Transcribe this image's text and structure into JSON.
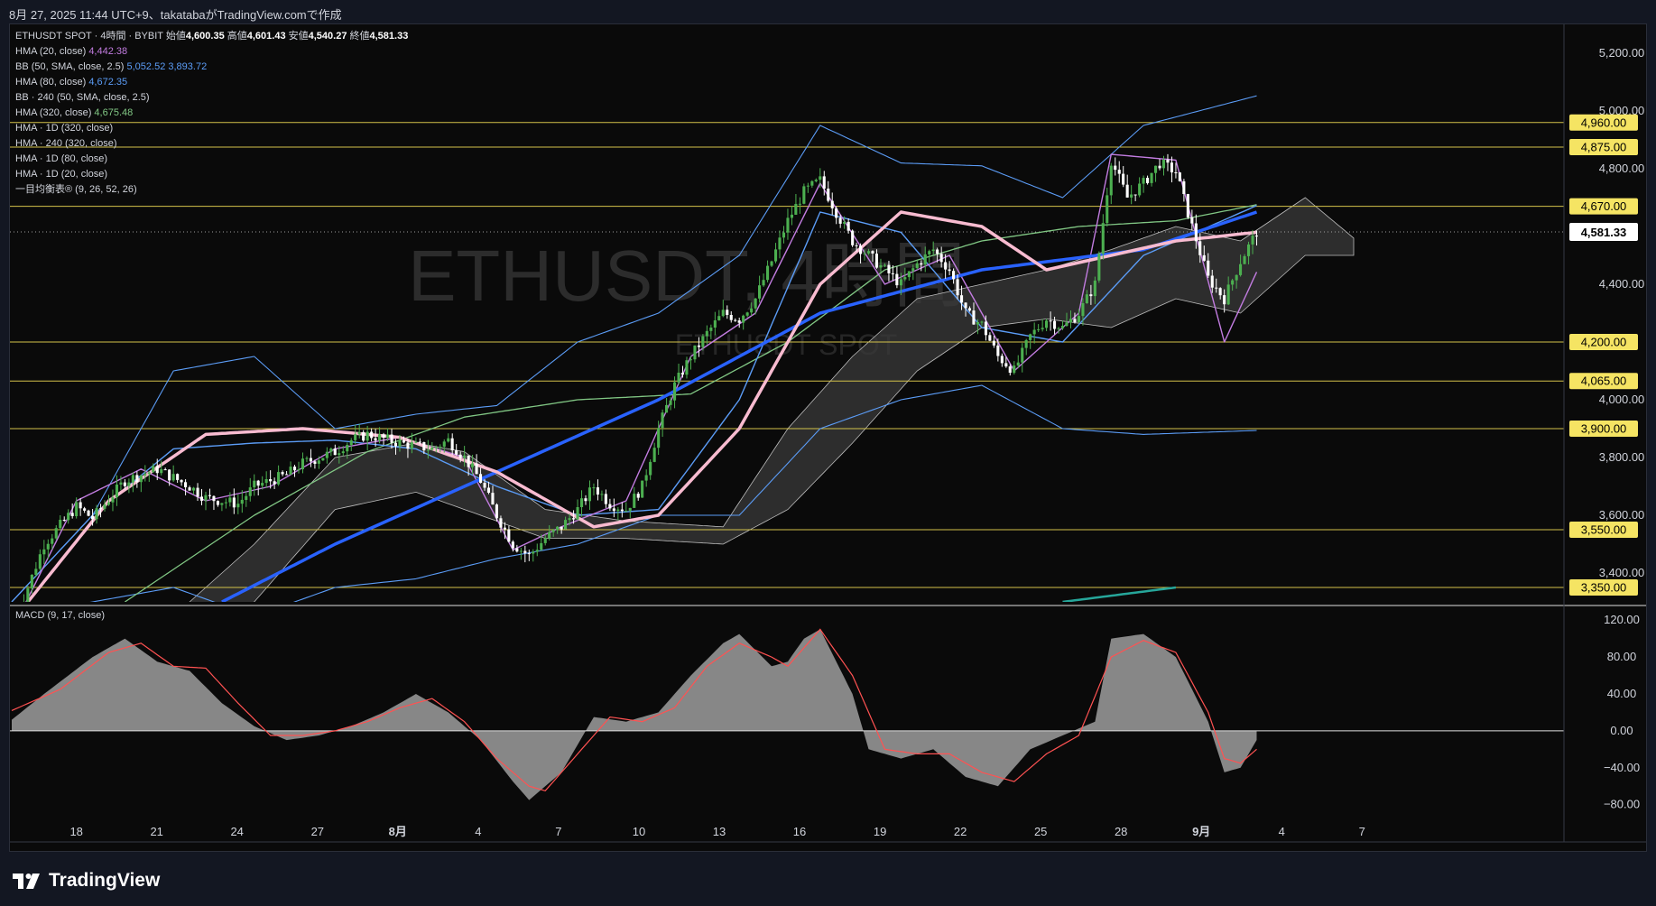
{
  "caption": "8月 27, 2025 11:44 UTC+9、takatabaがTradingView.comで作成",
  "legend": {
    "symbol_line": "ETHUSDT SPOT · 4時間 · BYBIT",
    "ohlc": [
      {
        "label": "始値",
        "value": "4,600.35"
      },
      {
        "label": "高値",
        "value": "4,601.43"
      },
      {
        "label": "安値",
        "value": "4,540.27"
      },
      {
        "label": "終値",
        "value": "4,581.33"
      }
    ],
    "indicators": [
      {
        "label": "HMA (20, close)",
        "values": [
          "4,442.38"
        ],
        "colors": [
          "#c27ce0"
        ]
      },
      {
        "label": "BB (50, SMA, close, 2.5)",
        "values": [
          "5,052.52",
          "3,893.72"
        ],
        "colors": [
          "#5b9cf6",
          "#5b9cf6"
        ]
      },
      {
        "label": "HMA (80, close)",
        "values": [
          "4,672.35"
        ],
        "colors": [
          "#5b9cf6"
        ]
      },
      {
        "label": "BB · 240 (50, SMA, close, 2.5)",
        "values": [],
        "colors": []
      },
      {
        "label": "HMA (320, close)",
        "values": [
          "4,675.48"
        ],
        "colors": [
          "#81c784"
        ]
      },
      {
        "label": "HMA · 1D (320, close)",
        "values": [],
        "colors": []
      },
      {
        "label": "HMA · 240 (320, close)",
        "values": [],
        "colors": []
      },
      {
        "label": "HMA · 1D (80, close)",
        "values": [],
        "colors": []
      },
      {
        "label": "HMA · 1D (20, close)",
        "values": [],
        "colors": []
      },
      {
        "label": "一目均衡表® (9, 26, 52, 26)",
        "values": [],
        "colors": []
      }
    ]
  },
  "watermark": {
    "main": "ETHUSDT, 4時間",
    "sub": "ETHUSDT SPOT"
  },
  "macd_label": "MACD (9, 17, close)",
  "brand": "TradingView",
  "colors": {
    "up": "#4caf50",
    "down": "#ffffff",
    "hline": "#d4c24a",
    "badge": "#f5e463",
    "bb": "#5b9cf6",
    "hma20": "#c27ce0",
    "hma80": "#5b9cf6",
    "hma320": "#81c784",
    "hma_daily": "#2962ff",
    "hma_daily20": "#f8bbd0",
    "macd": "#ff5252",
    "hist": "#9e9e9e"
  },
  "chart_data": [
    {
      "type": "candlestick",
      "title": "ETHUSDT SPOT · 4時間 · BYBIT",
      "y_axis_ticks": [
        "5,200.00",
        "5,000.00",
        "4,800.00",
        "4,400.00",
        "4,000.00",
        "3,800.00",
        "3,600.00",
        "3,400.00"
      ],
      "ylim": [
        3300,
        5300
      ],
      "x_axis_ticks": [
        "18",
        "21",
        "24",
        "27",
        "8月",
        "4",
        "7",
        "10",
        "13",
        "16",
        "19",
        "22",
        "25",
        "28",
        "9月",
        "4",
        "7"
      ],
      "horizontal_levels": [
        4960,
        4875,
        4670,
        4200,
        4065,
        3900,
        3550,
        3350
      ],
      "horizontal_level_labels": [
        "4,960.00",
        "4,875.00",
        "4,670.00",
        "4,200.00",
        "4,065.00",
        "3,900.00",
        "3,550.00",
        "3,350.00"
      ],
      "last_price": 4581.33,
      "last_price_label": "4,581.33",
      "price_path": [
        [
          0,
          3200
        ],
        [
          2,
          3500
        ],
        [
          4,
          3630
        ],
        [
          5,
          3590
        ],
        [
          7,
          3720
        ],
        [
          9,
          3760
        ],
        [
          11,
          3700
        ],
        [
          12,
          3660
        ],
        [
          14,
          3640
        ],
        [
          15,
          3700
        ],
        [
          17,
          3740
        ],
        [
          18,
          3780
        ],
        [
          20,
          3820
        ],
        [
          21,
          3860
        ],
        [
          22,
          3880
        ],
        [
          24,
          3850
        ],
        [
          26,
          3830
        ],
        [
          27,
          3860
        ],
        [
          28,
          3800
        ],
        [
          29,
          3720
        ],
        [
          30,
          3600
        ],
        [
          31,
          3500
        ],
        [
          32,
          3460
        ],
        [
          33,
          3520
        ],
        [
          34,
          3560
        ],
        [
          35,
          3620
        ],
        [
          36,
          3700
        ],
        [
          37,
          3640
        ],
        [
          38,
          3620
        ],
        [
          39,
          3700
        ],
        [
          40,
          3900
        ],
        [
          41,
          4050
        ],
        [
          42,
          4150
        ],
        [
          43,
          4230
        ],
        [
          44,
          4300
        ],
        [
          45,
          4280
        ],
        [
          46,
          4350
        ],
        [
          47,
          4480
        ],
        [
          48,
          4620
        ],
        [
          49,
          4720
        ],
        [
          50,
          4760
        ],
        [
          51,
          4650
        ],
        [
          52,
          4550
        ],
        [
          53,
          4500
        ],
        [
          54,
          4450
        ],
        [
          55,
          4400
        ],
        [
          56,
          4470
        ],
        [
          57,
          4520
        ],
        [
          58,
          4450
        ],
        [
          59,
          4300
        ],
        [
          60,
          4260
        ],
        [
          61,
          4150
        ],
        [
          62,
          4100
        ],
        [
          63,
          4220
        ],
        [
          64,
          4280
        ],
        [
          65,
          4250
        ],
        [
          66,
          4300
        ],
        [
          67,
          4400
        ],
        [
          68,
          4830
        ],
        [
          69,
          4700
        ],
        [
          70,
          4750
        ],
        [
          71,
          4820
        ],
        [
          72,
          4790
        ],
        [
          73,
          4600
        ],
        [
          74,
          4420
        ],
        [
          75,
          4350
        ],
        [
          76,
          4480
        ],
        [
          77,
          4581.33
        ]
      ],
      "ichimoku_cloud": {
        "upper": [
          [
            11,
            3300
          ],
          [
            15,
            3500
          ],
          [
            20,
            3800
          ],
          [
            25,
            3850
          ],
          [
            28,
            3820
          ],
          [
            33,
            3620
          ],
          [
            38,
            3580
          ],
          [
            44,
            3560
          ],
          [
            48,
            3900
          ],
          [
            52,
            4150
          ],
          [
            56,
            4350
          ],
          [
            60,
            4400
          ],
          [
            64,
            4450
          ],
          [
            68,
            4520
          ],
          [
            72,
            4600
          ],
          [
            76,
            4550
          ],
          [
            80,
            4700
          ],
          [
            83,
            4560
          ]
        ],
        "lower": [
          [
            11,
            3200
          ],
          [
            15,
            3300
          ],
          [
            20,
            3620
          ],
          [
            25,
            3680
          ],
          [
            28,
            3620
          ],
          [
            33,
            3520
          ],
          [
            38,
            3520
          ],
          [
            44,
            3500
          ],
          [
            48,
            3620
          ],
          [
            52,
            3850
          ],
          [
            56,
            4100
          ],
          [
            60,
            4250
          ],
          [
            64,
            4280
          ],
          [
            68,
            4250
          ],
          [
            72,
            4350
          ],
          [
            76,
            4300
          ],
          [
            80,
            4500
          ],
          [
            83,
            4500
          ]
        ]
      },
      "bollinger_upper": [
        [
          0,
          3300
        ],
        [
          5,
          3600
        ],
        [
          10,
          4100
        ],
        [
          15,
          4150
        ],
        [
          20,
          3900
        ],
        [
          25,
          3950
        ],
        [
          30,
          3980
        ],
        [
          35,
          4200
        ],
        [
          40,
          4300
        ],
        [
          45,
          4500
        ],
        [
          50,
          4950
        ],
        [
          55,
          4820
        ],
        [
          60,
          4810
        ],
        [
          65,
          4700
        ],
        [
          70,
          4950
        ],
        [
          77,
          5052.52
        ]
      ],
      "bollinger_lower": [
        [
          0,
          3250
        ],
        [
          5,
          3300
        ],
        [
          10,
          3350
        ],
        [
          15,
          3250
        ],
        [
          20,
          3350
        ],
        [
          25,
          3380
        ],
        [
          30,
          3450
        ],
        [
          35,
          3500
        ],
        [
          40,
          3600
        ],
        [
          45,
          3600
        ],
        [
          50,
          3900
        ],
        [
          55,
          4000
        ],
        [
          60,
          4050
        ],
        [
          65,
          3900
        ],
        [
          70,
          3880
        ],
        [
          77,
          3893.72
        ]
      ],
      "hma20": [
        [
          0,
          3200
        ],
        [
          4,
          3650
        ],
        [
          8,
          3760
        ],
        [
          12,
          3650
        ],
        [
          16,
          3700
        ],
        [
          20,
          3830
        ],
        [
          24,
          3870
        ],
        [
          28,
          3800
        ],
        [
          31,
          3480
        ],
        [
          34,
          3560
        ],
        [
          38,
          3650
        ],
        [
          42,
          4150
        ],
        [
          46,
          4300
        ],
        [
          50,
          4750
        ],
        [
          54,
          4400
        ],
        [
          58,
          4500
        ],
        [
          62,
          4100
        ],
        [
          66,
          4300
        ],
        [
          68,
          4850
        ],
        [
          72,
          4830
        ],
        [
          75,
          4200
        ],
        [
          77,
          4442.38
        ]
      ],
      "hma80": [
        [
          0,
          3300
        ],
        [
          5,
          3600
        ],
        [
          10,
          3830
        ],
        [
          15,
          3850
        ],
        [
          20,
          3860
        ],
        [
          25,
          3830
        ],
        [
          30,
          3700
        ],
        [
          35,
          3600
        ],
        [
          40,
          3620
        ],
        [
          45,
          4000
        ],
        [
          50,
          4650
        ],
        [
          55,
          4580
        ],
        [
          60,
          4250
        ],
        [
          65,
          4200
        ],
        [
          70,
          4500
        ],
        [
          77,
          4672.35
        ]
      ],
      "hma320": [
        [
          7,
          3300
        ],
        [
          15,
          3600
        ],
        [
          22,
          3820
        ],
        [
          28,
          3940
        ],
        [
          35,
          4000
        ],
        [
          42,
          4020
        ],
        [
          48,
          4200
        ],
        [
          54,
          4450
        ],
        [
          60,
          4550
        ],
        [
          66,
          4600
        ],
        [
          72,
          4620
        ],
        [
          77,
          4675.48
        ]
      ],
      "hma_daily_320": [
        [
          13,
          3300
        ],
        [
          20,
          3500
        ],
        [
          30,
          3750
        ],
        [
          40,
          4000
        ],
        [
          50,
          4300
        ],
        [
          60,
          4450
        ],
        [
          70,
          4520
        ],
        [
          77,
          4650
        ]
      ],
      "hma_daily_20": [
        [
          1,
          3300
        ],
        [
          6,
          3650
        ],
        [
          12,
          3880
        ],
        [
          18,
          3900
        ],
        [
          24,
          3870
        ],
        [
          30,
          3750
        ],
        [
          36,
          3560
        ],
        [
          40,
          3600
        ],
        [
          45,
          3900
        ],
        [
          50,
          4400
        ],
        [
          55,
          4650
        ],
        [
          60,
          4600
        ],
        [
          64,
          4450
        ],
        [
          68,
          4500
        ],
        [
          72,
          4550
        ],
        [
          77,
          4580
        ]
      ],
      "ichimoku_lagging": [
        [
          65,
          3300
        ],
        [
          72,
          3350
        ]
      ]
    },
    {
      "type": "area",
      "title": "MACD (9, 17, close)",
      "y_axis_ticks": [
        "120.00",
        "80.00",
        "40.00",
        "0.00",
        "−40.00",
        "−80.00"
      ],
      "ylim": [
        -95,
        130
      ],
      "zero_line": 0,
      "histogram": [
        [
          0,
          12
        ],
        [
          2,
          40
        ],
        [
          5,
          80
        ],
        [
          7,
          100
        ],
        [
          9,
          75
        ],
        [
          11,
          65
        ],
        [
          13,
          30
        ],
        [
          15,
          5
        ],
        [
          17,
          -10
        ],
        [
          19,
          -5
        ],
        [
          21,
          5
        ],
        [
          23,
          20
        ],
        [
          25,
          40
        ],
        [
          27,
          20
        ],
        [
          29,
          -10
        ],
        [
          31,
          -55
        ],
        [
          32,
          -75
        ],
        [
          34,
          -45
        ],
        [
          36,
          15
        ],
        [
          38,
          10
        ],
        [
          40,
          20
        ],
        [
          42,
          60
        ],
        [
          44,
          95
        ],
        [
          45,
          105
        ],
        [
          47,
          70
        ],
        [
          48,
          75
        ],
        [
          49,
          100
        ],
        [
          50,
          110
        ],
        [
          52,
          40
        ],
        [
          53,
          -20
        ],
        [
          55,
          -30
        ],
        [
          57,
          -20
        ],
        [
          59,
          -50
        ],
        [
          61,
          -60
        ],
        [
          63,
          -20
        ],
        [
          65,
          -5
        ],
        [
          67,
          10
        ],
        [
          68,
          100
        ],
        [
          70,
          105
        ],
        [
          72,
          80
        ],
        [
          74,
          10
        ],
        [
          75,
          -45
        ],
        [
          76,
          -40
        ],
        [
          77,
          -10
        ]
      ],
      "signal": [
        [
          0,
          22
        ],
        [
          3,
          45
        ],
        [
          6,
          85
        ],
        [
          8,
          95
        ],
        [
          10,
          70
        ],
        [
          12,
          68
        ],
        [
          14,
          30
        ],
        [
          16,
          -5
        ],
        [
          18,
          -5
        ],
        [
          20,
          0
        ],
        [
          22,
          10
        ],
        [
          24,
          25
        ],
        [
          26,
          35
        ],
        [
          28,
          10
        ],
        [
          30,
          -30
        ],
        [
          32,
          -60
        ],
        [
          33,
          -65
        ],
        [
          35,
          -25
        ],
        [
          37,
          15
        ],
        [
          39,
          10
        ],
        [
          41,
          25
        ],
        [
          43,
          70
        ],
        [
          45,
          95
        ],
        [
          47,
          80
        ],
        [
          48,
          70
        ],
        [
          50,
          110
        ],
        [
          52,
          60
        ],
        [
          54,
          -20
        ],
        [
          56,
          -25
        ],
        [
          58,
          -25
        ],
        [
          60,
          -45
        ],
        [
          62,
          -55
        ],
        [
          64,
          -25
        ],
        [
          66,
          -5
        ],
        [
          68,
          80
        ],
        [
          70,
          98
        ],
        [
          72,
          85
        ],
        [
          74,
          20
        ],
        [
          75,
          -30
        ],
        [
          76,
          -35
        ],
        [
          77,
          -20
        ]
      ]
    }
  ]
}
